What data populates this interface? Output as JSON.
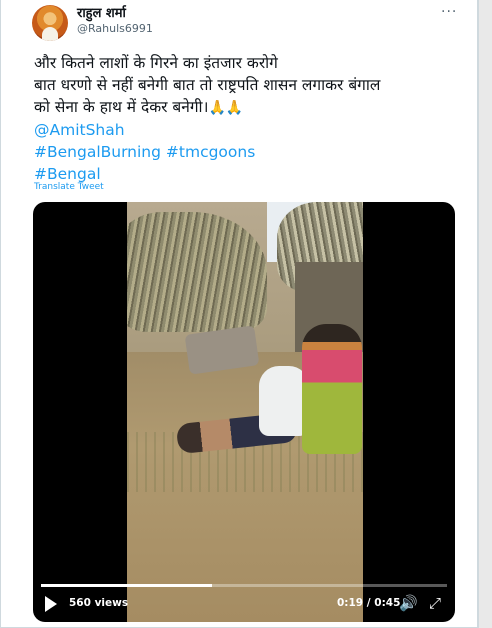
{
  "author": {
    "name": "राहुल शर्मा",
    "handle": "@Rahuls6991",
    "avatar_icon": "avatar-icon"
  },
  "more_icon": "more-options-icon",
  "more_glyph": "···",
  "tweet": {
    "lines": [
      "और कितने लाशों के गिरने का इंतजार करोगे",
      "बात धरणो से नहीं बनेगी बात तो राष्ट्रपति शासन लगाकर बंगाल",
      "को सेना के हाथ में देकर बनेगी।"
    ],
    "emoji": "🙏🙏",
    "mention": "@AmitShah",
    "hashtags_line1": "#BengalBurning #tmcgoons",
    "hashtags_line2": "#Bengal",
    "link_color": "#1d9bf0"
  },
  "translate_label": "Translate Tweet",
  "video": {
    "views": "560 views",
    "time": "0:19 / 0:45",
    "progress": 0.42,
    "play_icon": "play-icon",
    "volume_icon": "volume-icon",
    "volume_glyph": "🔊",
    "fullscreen_icon": "fullscreen-icon",
    "fullscreen_glyph": "⤢"
  }
}
